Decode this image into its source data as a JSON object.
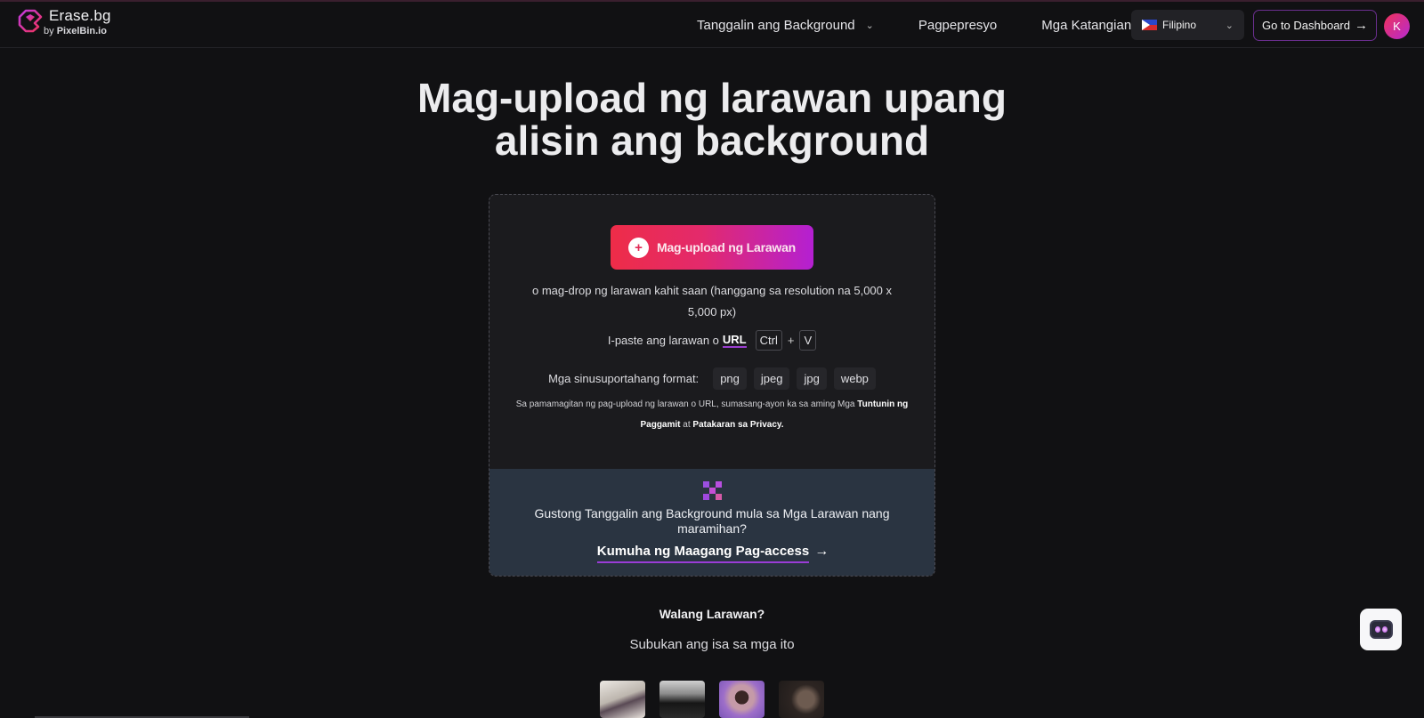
{
  "brand": {
    "name": "Erase.bg",
    "by_prefix": "by",
    "by_name": "PixelBin.io"
  },
  "nav": {
    "items": [
      {
        "label": "Tanggalin ang Background",
        "has_dropdown": true
      },
      {
        "label": "Pagpepresyo",
        "has_dropdown": false
      },
      {
        "label": "Mga Katangian",
        "has_dropdown": false
      }
    ],
    "language": {
      "selected": "Filipino",
      "flag_icon": "philippines-flag-icon"
    },
    "dashboard_button": "Go to Dashboard",
    "avatar_initial": "K"
  },
  "hero": {
    "title_line1": "Mag-upload ng larawan upang",
    "title_line2": "alisin ang background"
  },
  "upload": {
    "button_label": "Mag-upload ng Larawan",
    "drop_text": "o mag-drop ng larawan kahit saan (hanggang sa resolution na 5,000 x 5,000 px)",
    "paste_text": "I-paste ang larawan o",
    "paste_link": "URL",
    "shortcut_key1": "Ctrl",
    "shortcut_plus": "+",
    "shortcut_key2": "V",
    "formats_label": "Mga sinusuportahang format:",
    "formats": [
      "png",
      "jpeg",
      "jpg",
      "webp"
    ],
    "terms_prefix": "Sa pamamagitan ng pag-upload ng larawan o URL, sumasang-ayon ka sa aming Mga",
    "terms_link": "Tuntunin ng Paggamit",
    "terms_and": "at",
    "privacy_link": "Patakaran sa Privacy."
  },
  "bulk": {
    "text": "Gustong Tanggalin ang Background mula sa Mga Larawan nang maramihan?",
    "link": "Kumuha ng Maagang Pag-access",
    "link_arrow": "→"
  },
  "samples": {
    "heading": "Walang Larawan?",
    "subheading": "Subukan ang isa sa mga ito",
    "items": [
      "woman-with-hat",
      "black-car",
      "woman-purple-background",
      "man-portrait"
    ]
  },
  "colors": {
    "background": "#111113",
    "accent_start": "#ee2c48",
    "accent_end": "#b420d2",
    "bulk_panel": "#2a3441"
  }
}
